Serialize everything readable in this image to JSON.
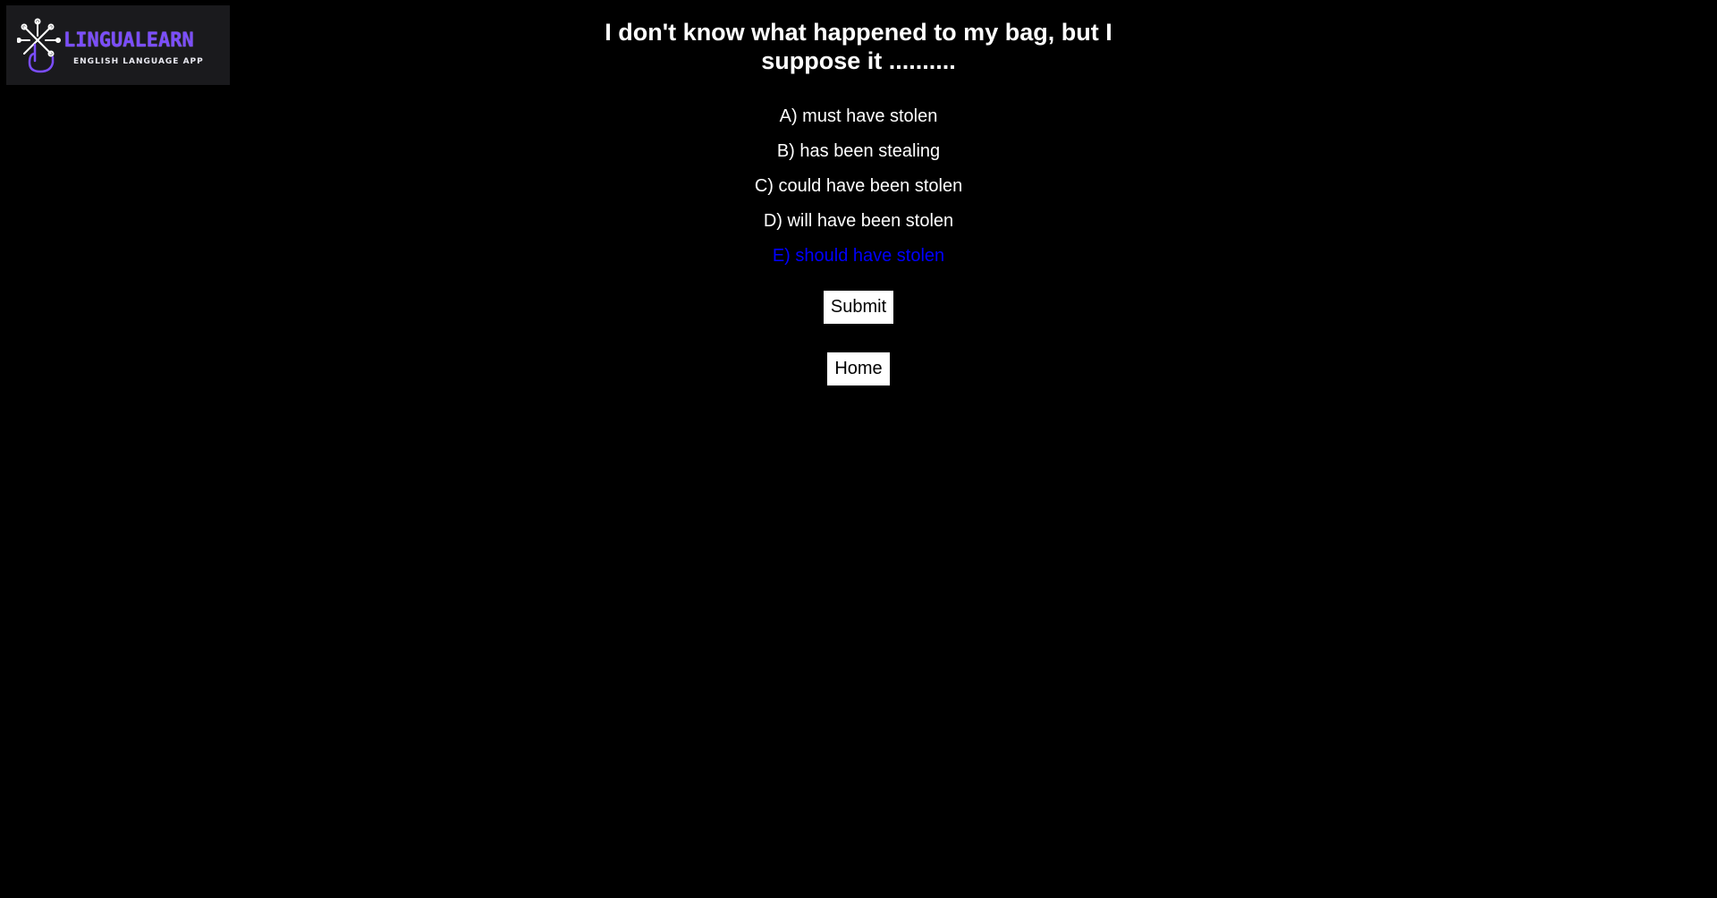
{
  "logo": {
    "title": "LINGUALEARN",
    "subtitle": "ENGLISH LANGUAGE APP",
    "accent_color": "#7b4dff"
  },
  "quiz": {
    "question": "I don't know what happened to my bag, but I suppose it ..........",
    "options": [
      {
        "label": "A) must have stolen",
        "selected": false
      },
      {
        "label": "B) has been stealing",
        "selected": false
      },
      {
        "label": "C) could have been stolen",
        "selected": false
      },
      {
        "label": "D) will have been stolen",
        "selected": false
      },
      {
        "label": "E) should have stolen",
        "selected": true
      }
    ],
    "selected_color": "#0000ff",
    "submit_label": "Submit",
    "home_label": "Home"
  }
}
